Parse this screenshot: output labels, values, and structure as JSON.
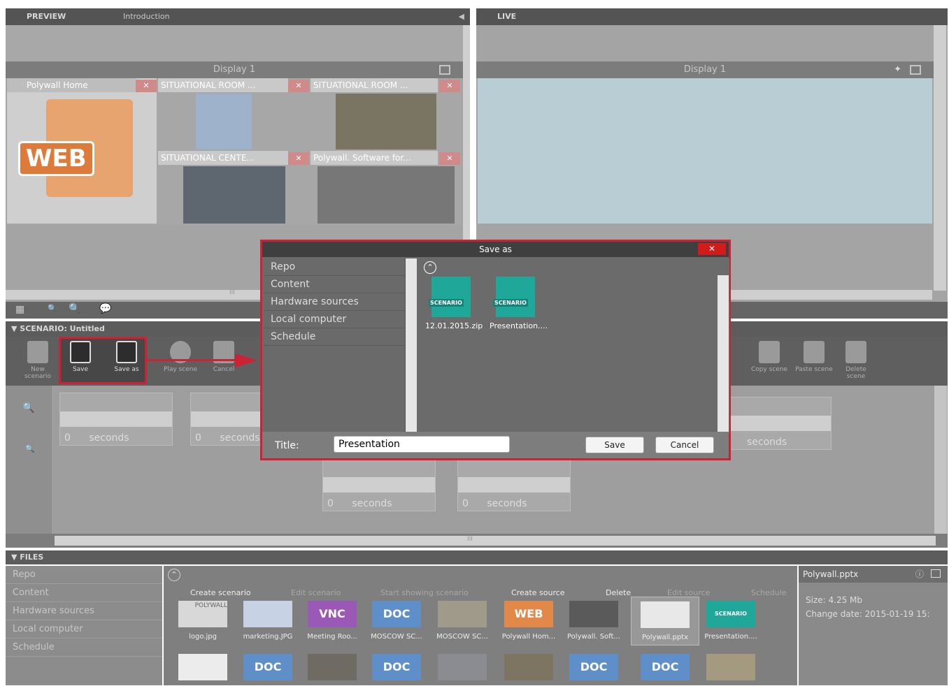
{
  "preview": {
    "header": "PREVIEW",
    "tab": "Introduction",
    "display_title": "Display 1"
  },
  "live": {
    "header": "LIVE",
    "display_title": "Display 1"
  },
  "tiles": [
    {
      "title": "Polywall Home"
    },
    {
      "title": "SITUATIONAL ROOM ..."
    },
    {
      "title": "SITUATIONAL ROOM ..."
    },
    {
      "title": "SITUATIONAL CENTE..."
    },
    {
      "title": "Polywall. Software for..."
    }
  ],
  "web_icon_text": "WEB",
  "scenario": {
    "header": "SCENARIO: Untitled",
    "toolbar": {
      "new": "New scenario",
      "save": "Save",
      "save_as": "Save as",
      "play": "Play scene",
      "cancel": "Cancel",
      "copy": "Copy scene",
      "paste": "Paste scene",
      "delete": "Delete scene"
    },
    "scene_duration": "0 seconds",
    "scene_duration_right": "seconds",
    "scroll_mark": "III"
  },
  "files": {
    "header": "FILES",
    "sidebar": [
      "Repo",
      "Content",
      "Hardware sources",
      "Local computer",
      "Schedule"
    ],
    "actions": {
      "create_scenario": "Create scenario",
      "edit_scenario": "Edit scenario",
      "start_showing": "Start showing scenario",
      "create_source": "Create source",
      "delete": "Delete",
      "edit_source": "Edit source",
      "schedule": "Schedule"
    },
    "items": [
      {
        "label": "logo.jpg",
        "thumb": "POLYWALL"
      },
      {
        "label": "marketing.JPG",
        "thumb": ""
      },
      {
        "label": "Meeting Roo...",
        "thumb": "VNC"
      },
      {
        "label": "MOSCOW SC...",
        "thumb": "DOC"
      },
      {
        "label": "MOSCOW SC...",
        "thumb": ""
      },
      {
        "label": "Polywall Hom...",
        "thumb": "WEB"
      },
      {
        "label": "Polywall. Soft...",
        "thumb": ""
      },
      {
        "label": "Polywall.pptx",
        "thumb": ""
      },
      {
        "label": "Presentation....",
        "thumb": "SCENARIO"
      }
    ],
    "row2_thumbs": [
      "",
      "DOC",
      "",
      "DOC",
      "",
      "",
      "DOC",
      "DOC",
      ""
    ],
    "info": {
      "filename": "Polywall.pptx",
      "size": "Size: 4.25 Mb",
      "change_date": "Change date: 2015-01-19 15:"
    }
  },
  "dialog": {
    "title": "Save as",
    "close": "✕",
    "sidebar": [
      "Repo",
      "Content",
      "Hardware sources",
      "Local computer",
      "Schedule"
    ],
    "files": [
      {
        "label": "12.01.2015.zip",
        "badge": "SCENARIO"
      },
      {
        "label": "Presentation....",
        "badge": "SCENARIO"
      }
    ],
    "title_label": "Title:",
    "title_value": "Presentation",
    "save_button": "Save",
    "cancel_button": "Cancel"
  },
  "colors": {
    "highlight": "#cc2233",
    "scenario_teal": "#1fa79a",
    "doc_blue": "#5e8fc8",
    "live_area": "#cfe4eb"
  }
}
